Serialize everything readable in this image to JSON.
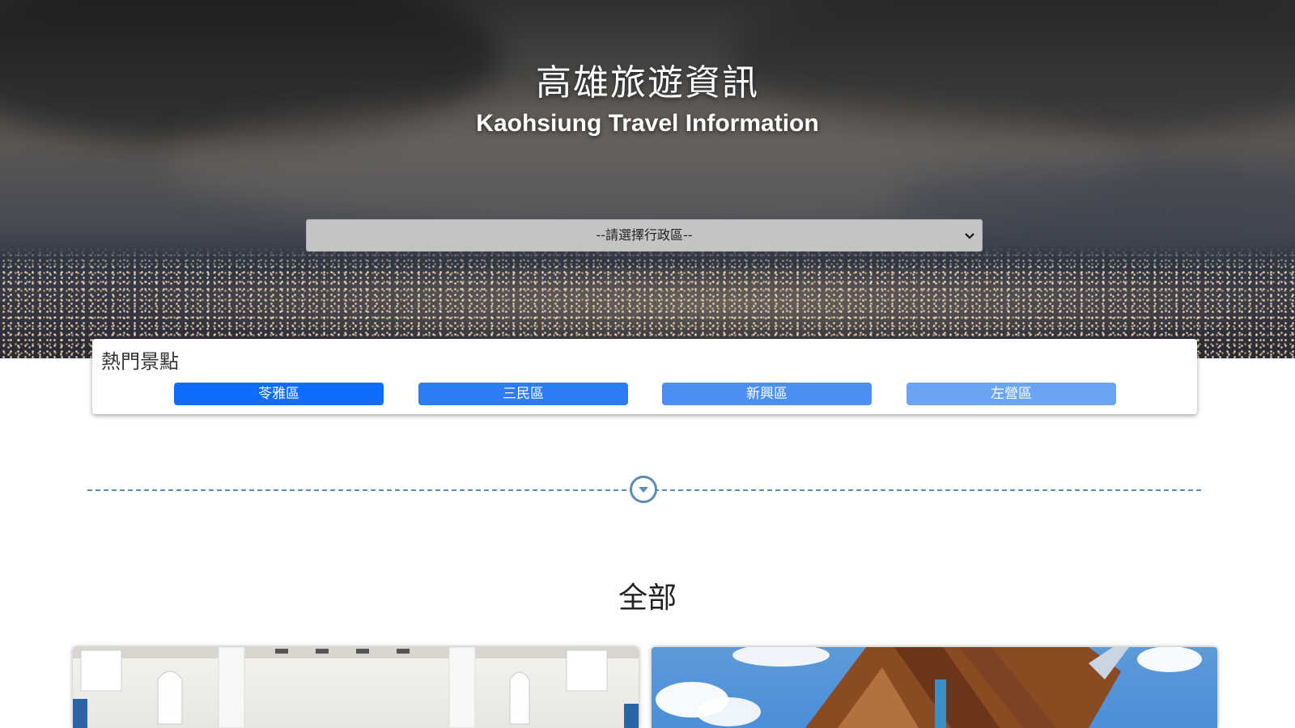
{
  "header": {
    "title_zh": "高雄旅遊資訊",
    "title_en": "Kaohsiung Travel Information"
  },
  "district_select": {
    "selected": "--請選擇行政區--"
  },
  "hot_spots": {
    "title": "熱門景點",
    "buttons": [
      "苓雅區",
      "三民區",
      "新興區",
      "左營區"
    ],
    "button_colors": [
      "#0d6efd",
      "#2b7cf5",
      "#4b8ff2",
      "#6aa4f3"
    ]
  },
  "divider": {
    "icon": "chevron-down-circle-icon",
    "color": "#5b8db3"
  },
  "results": {
    "title": "全部",
    "cards": [
      {
        "image": "white-hall-interior-photo"
      },
      {
        "image": "wooden-church-sky-photo"
      }
    ]
  }
}
